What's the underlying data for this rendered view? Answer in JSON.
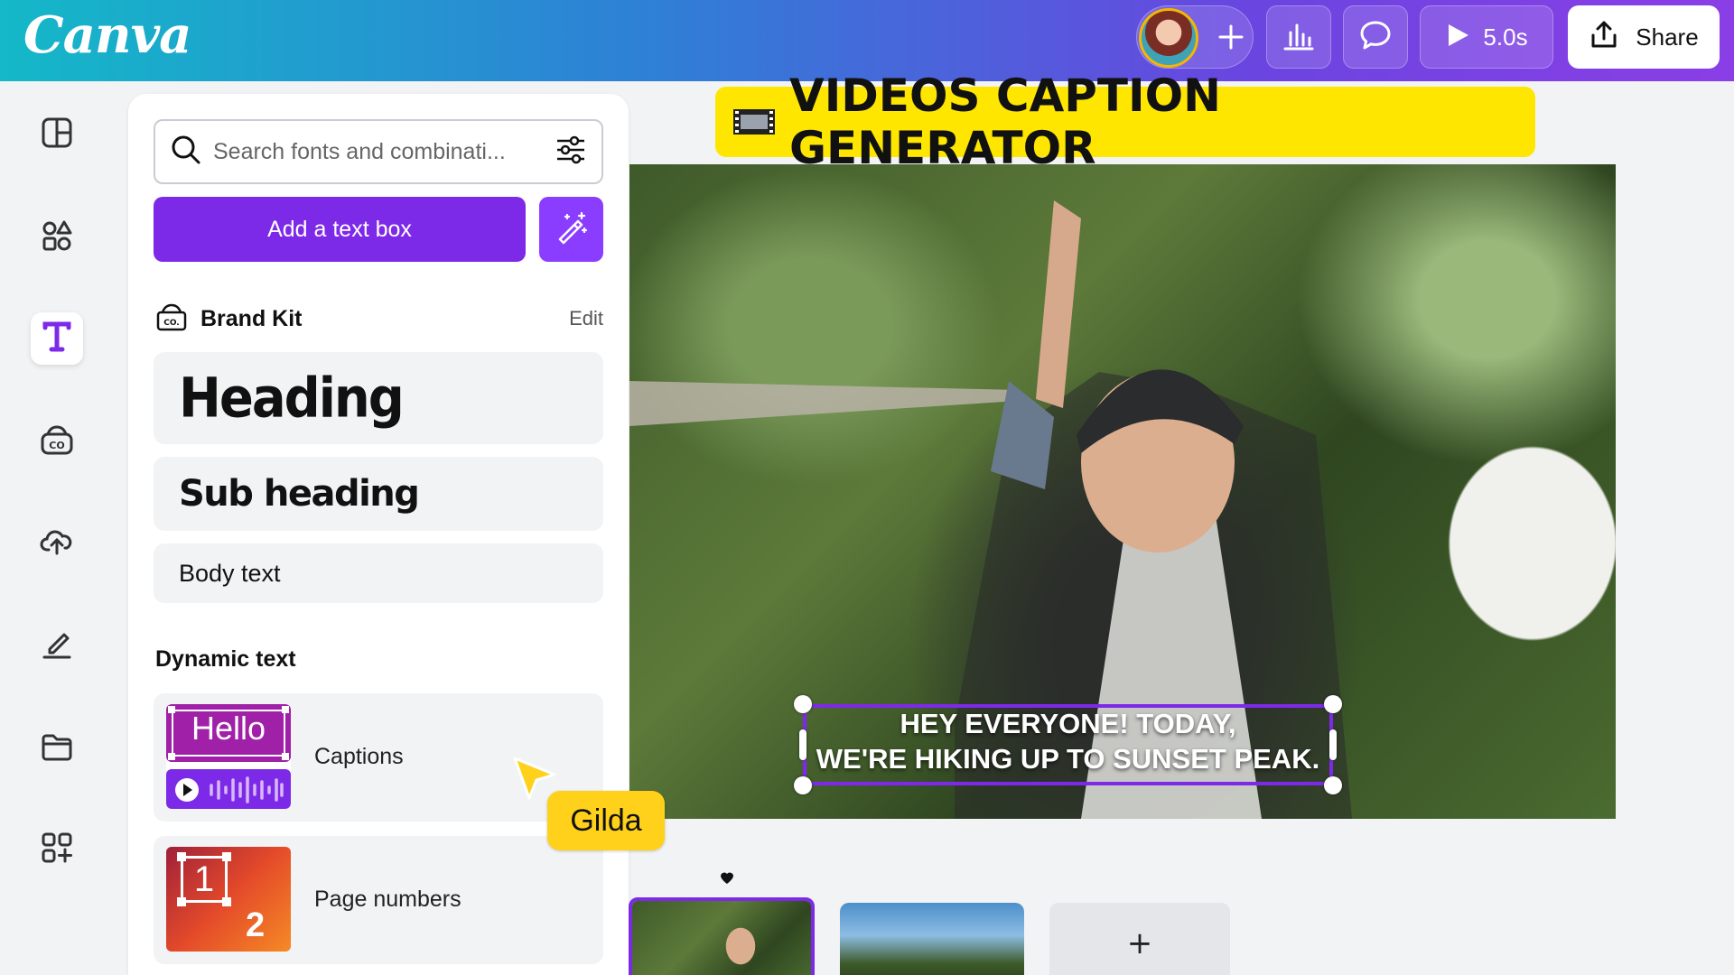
{
  "app": {
    "logo": "Canva"
  },
  "topbar": {
    "play_duration": "5.0s",
    "share_label": "Share",
    "icons": [
      "avatar",
      "plus-icon",
      "analytics-icon",
      "comment-icon",
      "play-icon",
      "share-icon"
    ]
  },
  "rail": {
    "icons": [
      "design-icon",
      "elements-icon",
      "text-icon",
      "brand-icon",
      "uploads-icon",
      "draw-icon",
      "projects-icon",
      "apps-icon"
    ],
    "active": "text-icon"
  },
  "panel": {
    "search_placeholder": "Search fonts and combinati...",
    "add_text_label": "Add a text box",
    "brand_kit_label": "Brand Kit",
    "brand_kit_edit": "Edit",
    "heading_label": "Heading",
    "subheading_label": "Sub heading",
    "body_label": "Body text",
    "dynamic_title": "Dynamic text",
    "captions_thumb_text": "Hello",
    "captions_label": "Captions",
    "pagenum_thumb_top": "1",
    "pagenum_thumb_bottom": "2",
    "pagenum_label": "Page numbers"
  },
  "canvas": {
    "banner_title": "VIDEOS CAPTION GENERATOR",
    "caption_line1": "HEY EVERYONE! TODAY,",
    "caption_line2": "WE'RE HIKING UP TO SUNSET PEAK.",
    "collaborator_name": "Gilda"
  },
  "timeline": {
    "add_page_label": "+"
  },
  "colors": {
    "accent": "#7d2ae8",
    "banner": "#ffe600",
    "cursor": "#ffd11a"
  }
}
